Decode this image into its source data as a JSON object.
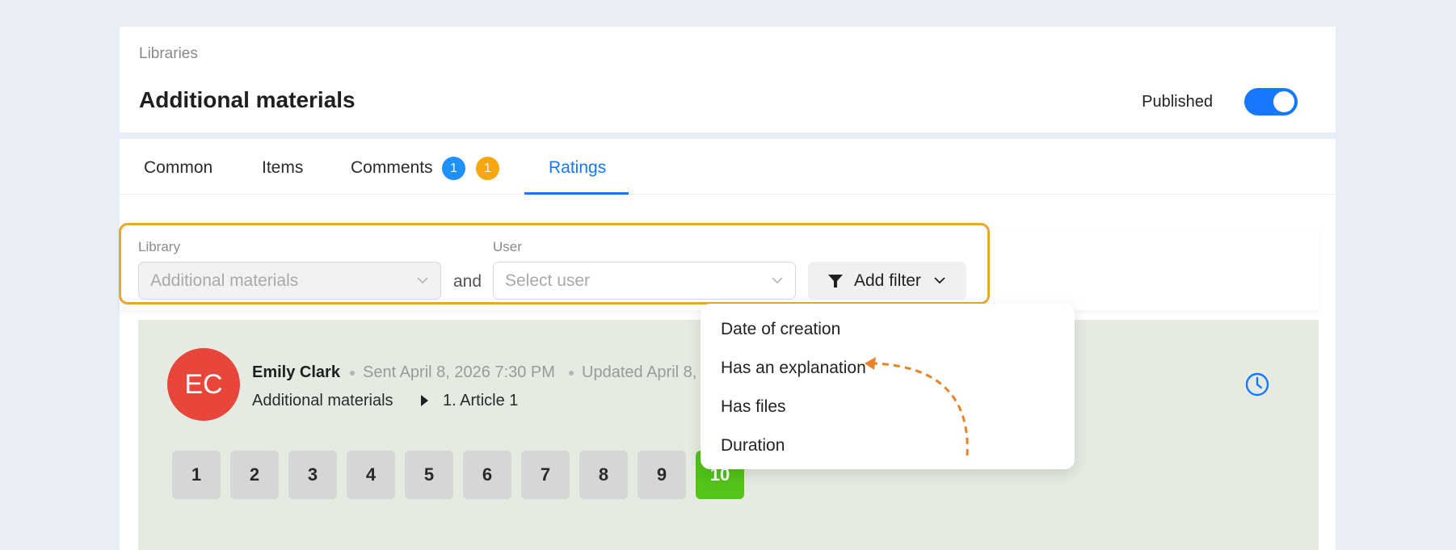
{
  "header": {
    "breadcrumb": "Libraries",
    "title": "Additional materials",
    "published_label": "Published",
    "published": true
  },
  "tabs": [
    {
      "label": "Common"
    },
    {
      "label": "Items"
    },
    {
      "label": "Comments",
      "badges": [
        "1",
        "1"
      ]
    },
    {
      "label": "Ratings",
      "active": true
    }
  ],
  "filters": {
    "library_label": "Library",
    "library_value": "Additional materials",
    "and_text": "and",
    "user_label": "User",
    "user_placeholder": "Select user",
    "add_filter_label": "Add filter"
  },
  "filter_menu": {
    "items": [
      "Date of creation",
      "Has an explanation",
      "Has files",
      "Duration"
    ]
  },
  "rating": {
    "avatar_initials": "EC",
    "author": "Emily Clark",
    "sent": "Sent April 8, 2026 7:30 PM",
    "updated": "Updated April 8,",
    "library": "Additional materials",
    "item": "1. Article 1",
    "scores": [
      "1",
      "2",
      "3",
      "4",
      "5",
      "6",
      "7",
      "8",
      "9",
      "10"
    ],
    "selected_score": "10"
  },
  "colors": {
    "accent": "#1677ff",
    "badge_blue": "#1e90ff",
    "badge_orange": "#f5a70f",
    "avatar": "#e8463a",
    "selected_score": "#52c41a",
    "highlight": "#eea62a"
  },
  "icons": [
    "funnel-icon",
    "chevron-down-icon",
    "caret-right-icon",
    "clock-icon"
  ]
}
